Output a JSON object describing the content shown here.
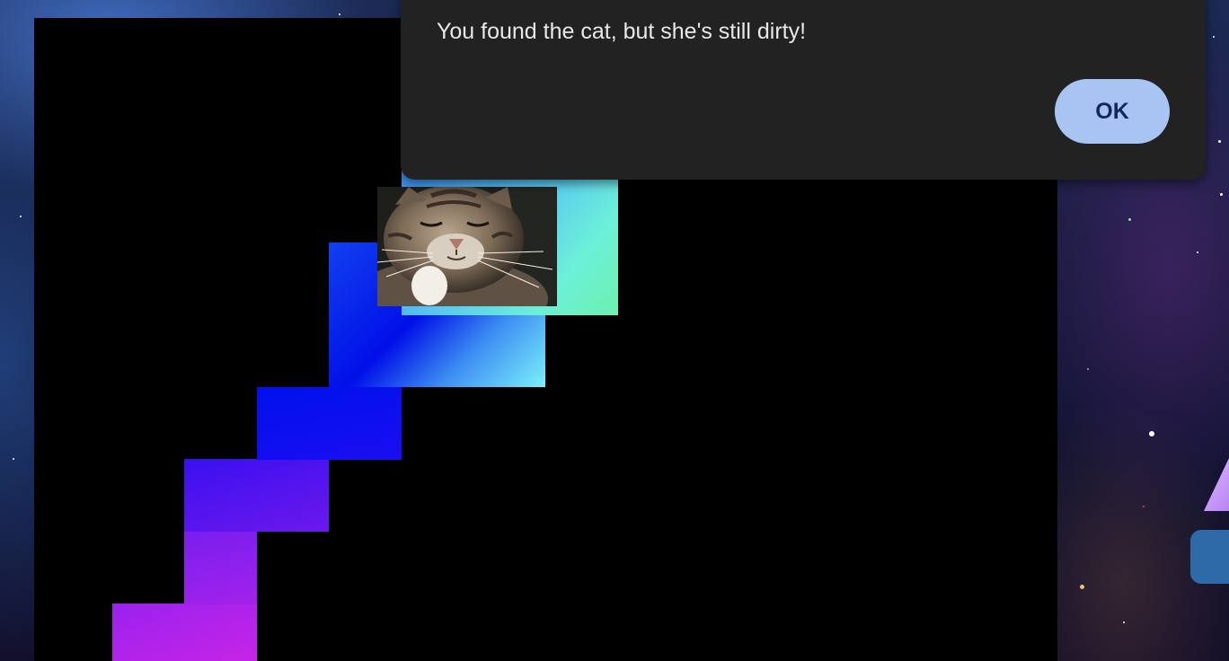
{
  "dialog": {
    "message": "You found the cat, but she's still dirty!",
    "ok_label": "OK"
  },
  "colors": {
    "board": "#000000",
    "dialog_background": "#222222",
    "ok_button": "#a8c4f3",
    "ok_text": "#0f2a5c",
    "side_button": "#2e6aa8"
  }
}
